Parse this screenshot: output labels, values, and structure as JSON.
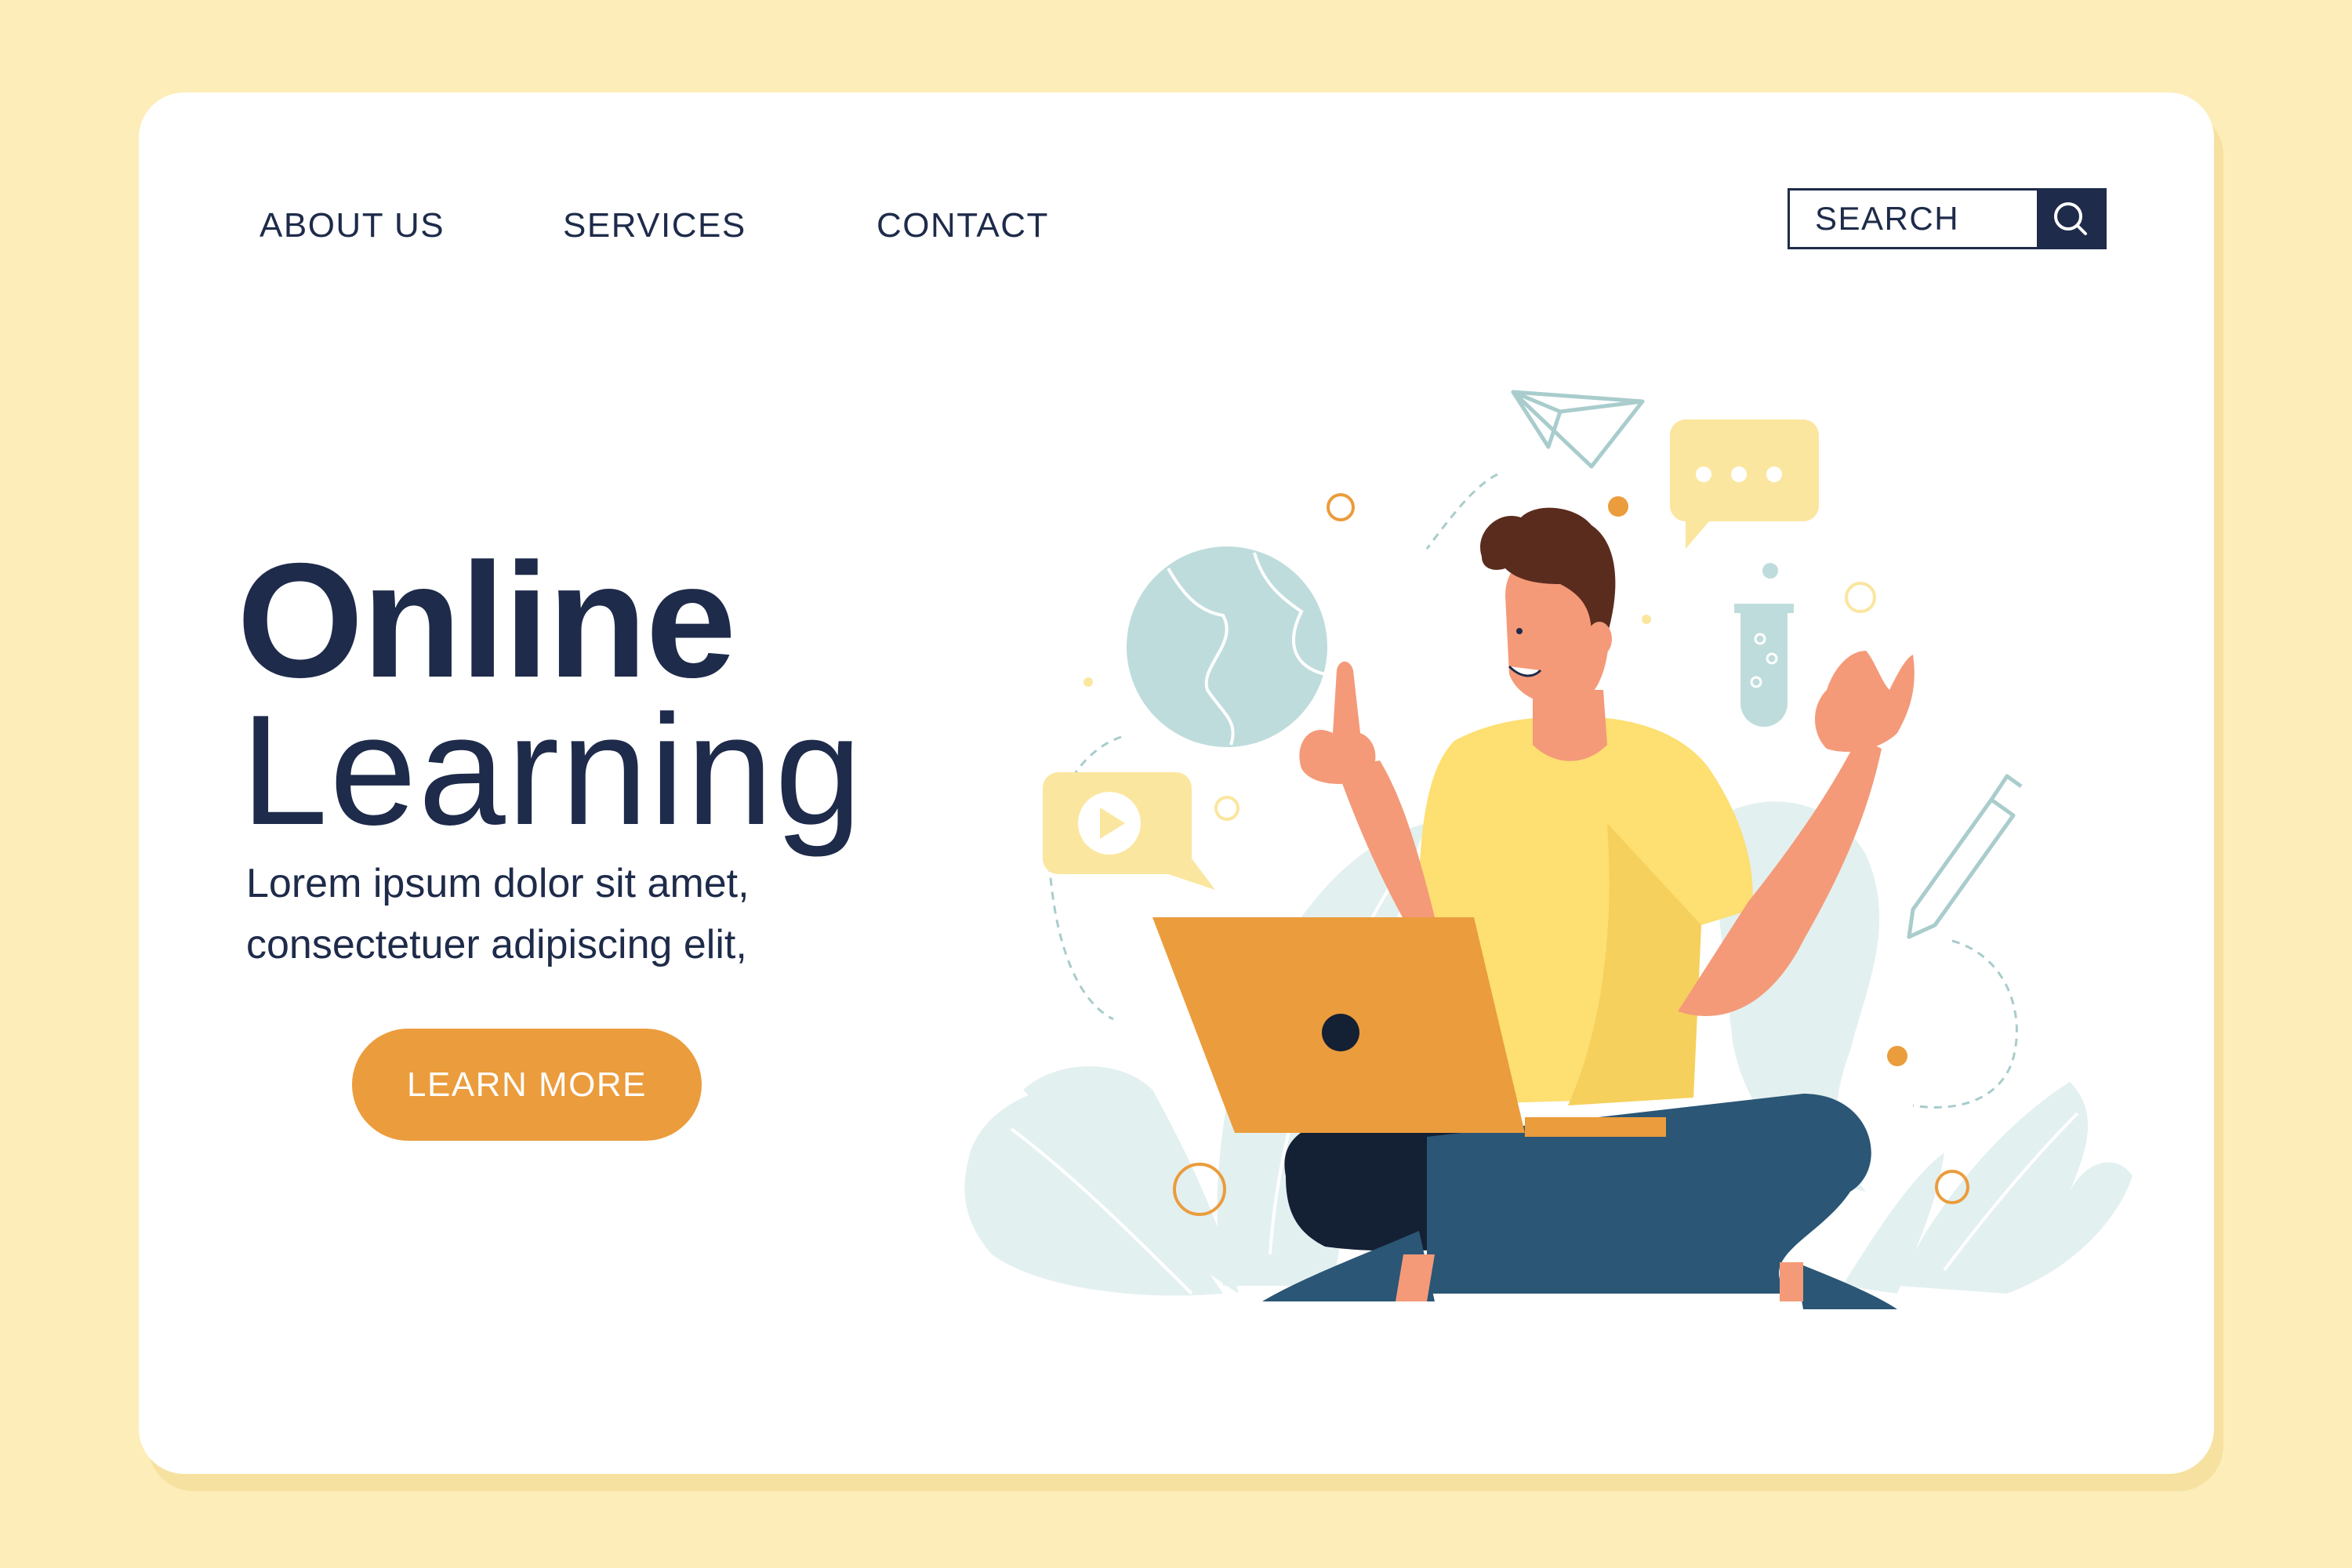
{
  "nav": {
    "about": "ABOUT US",
    "services": "SERVICES",
    "contact": "CONTACT"
  },
  "search": {
    "placeholder": "SEARCH",
    "icon": "search-icon"
  },
  "hero": {
    "title_line1": "Online",
    "title_line2": "Learning",
    "subtitle_line1": "Lorem ipsum dolor sit amet,",
    "subtitle_line2": "consectetuer adipiscing elit,",
    "cta_label": "LEARN MORE"
  },
  "colors": {
    "background": "#FDEDB9",
    "card": "#FFFFFF",
    "navy": "#1E2B4A",
    "accent_orange": "#EB9C3C",
    "shirt_yellow": "#FDDF72",
    "light_blue": "#BFDCDC",
    "skin": "#F49A79",
    "pants": "#2B5675"
  },
  "illustration": {
    "icons": [
      "paper-plane-icon",
      "chat-bubble-icon",
      "globe-icon",
      "test-tube-icon",
      "video-play-icon",
      "pencil-icon",
      "laptop-icon"
    ]
  }
}
